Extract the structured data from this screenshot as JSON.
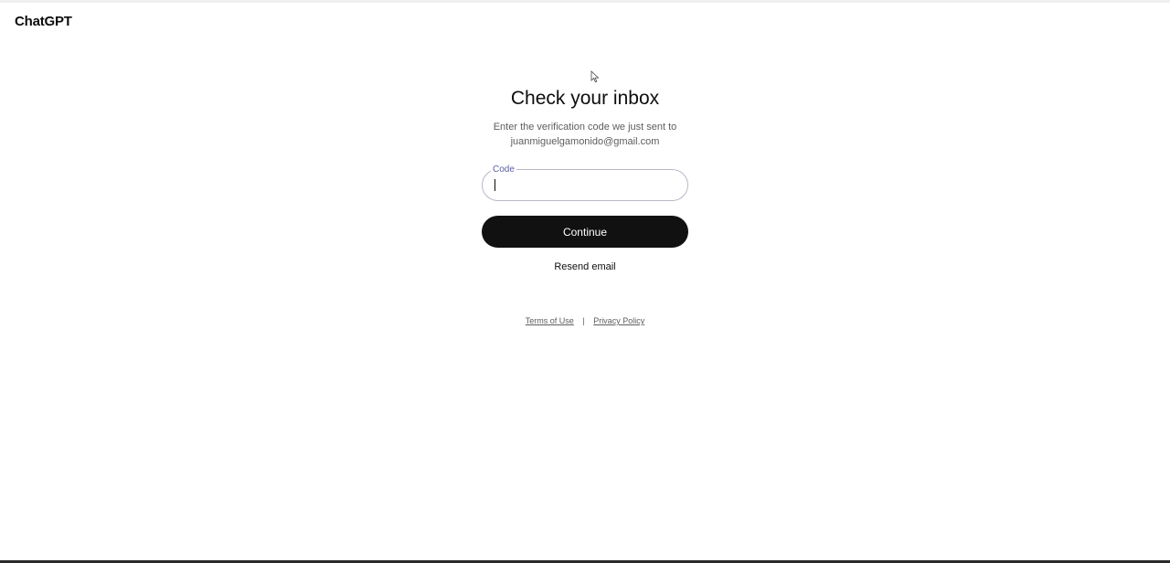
{
  "header": {
    "brand": "ChatGPT"
  },
  "verify": {
    "title": "Check your inbox",
    "subtitle": "Enter the verification code we just sent to",
    "email": "juanmiguelgamonido@gmail.com",
    "code_label": "Code",
    "code_value": "",
    "continue_label": "Continue",
    "resend_label": "Resend email"
  },
  "footer": {
    "terms": "Terms of Use",
    "separator": "|",
    "privacy": "Privacy Policy"
  },
  "colors": {
    "button_bg": "#111111",
    "field_label": "#5b5f9e",
    "field_border": "#b8b8c9"
  },
  "icons": {
    "pointer": "mouse-pointer-icon"
  }
}
